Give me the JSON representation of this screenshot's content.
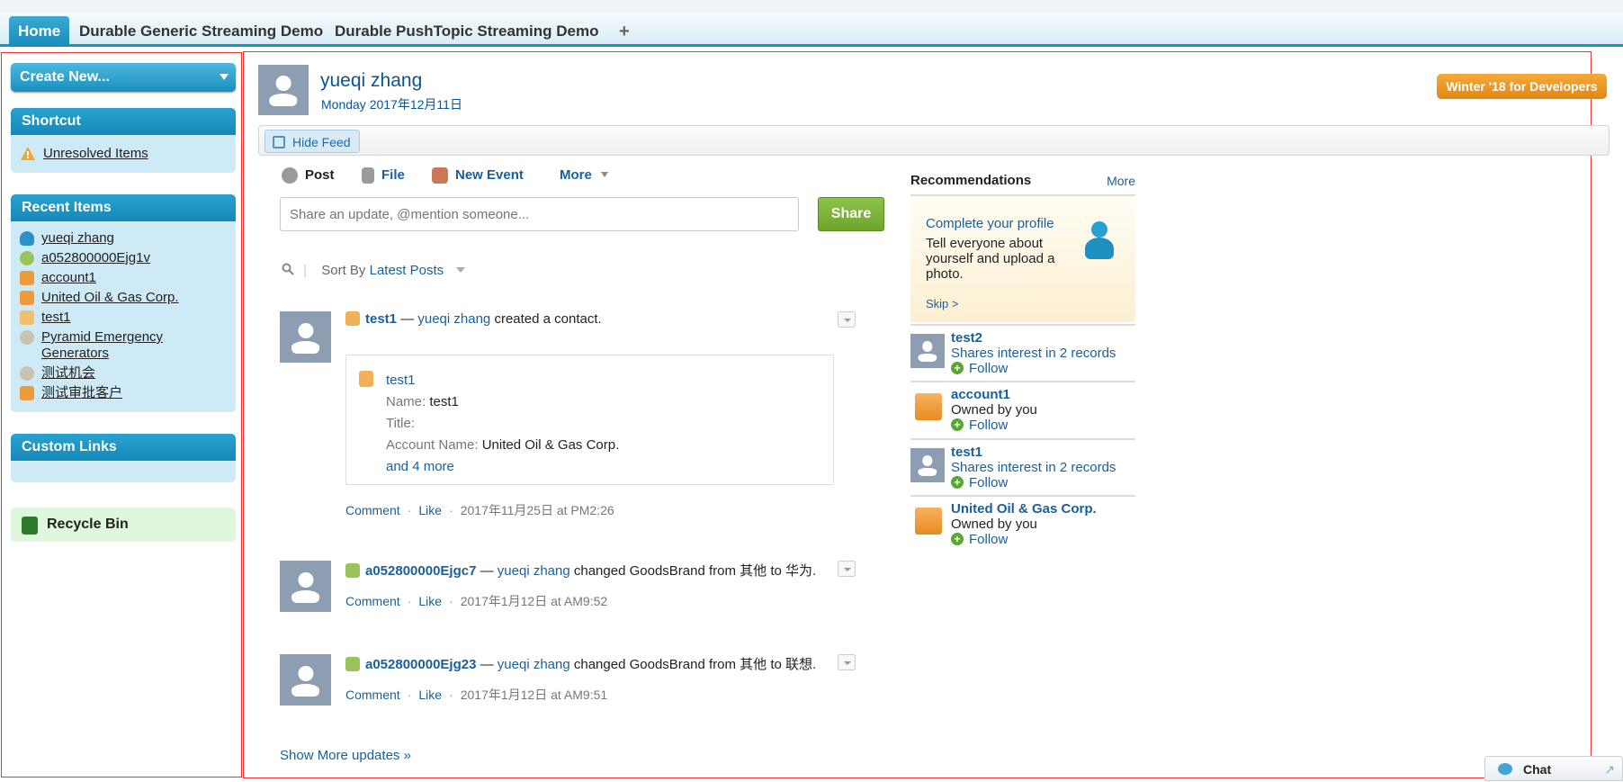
{
  "tabs": [
    "Home",
    "Durable Generic Streaming Demo",
    "Durable PushTopic Streaming Demo",
    "+"
  ],
  "sidebar": {
    "create_new": "Create New...",
    "shortcut_title": "Shortcut",
    "shortcut_items": [
      {
        "label": "Unresolved Items",
        "icon": "warning-icon"
      }
    ],
    "recent_title": "Recent Items",
    "recent_items": [
      {
        "label": "yueqi zhang",
        "icon": "user-icon"
      },
      {
        "label": "a052800000Ejg1v",
        "icon": "custom-object-icon"
      },
      {
        "label": "account1",
        "icon": "account-icon"
      },
      {
        "label": "United Oil & Gas Corp.",
        "icon": "account-icon"
      },
      {
        "label": "test1",
        "icon": "contact-icon"
      },
      {
        "label": "Pyramid Emergency Generators",
        "icon": "opportunity-icon"
      },
      {
        "label": "测试机会",
        "icon": "opportunity-icon"
      },
      {
        "label": "测试审批客户",
        "icon": "account-icon"
      }
    ],
    "custom_links_title": "Custom Links",
    "recycle_bin": "Recycle Bin"
  },
  "profile": {
    "name": "yueqi zhang",
    "date": "Monday 2017年12月11日"
  },
  "release_button": "Winter '18 for Developers",
  "feed": {
    "hide_feed": "Hide Feed",
    "composer_tabs": [
      "Post",
      "File",
      "New Event",
      "More"
    ],
    "share_placeholder": "Share an update, @mention someone...",
    "share_button": "Share",
    "sort_label": "Sort By",
    "sort_value": "Latest Posts",
    "comment": "Comment",
    "like": "Like",
    "posts": [
      {
        "actor": "test1",
        "dash": " — ",
        "user": "yueqi zhang",
        "text": " created a contact.",
        "card": {
          "name": "test1",
          "name_label": "Name:",
          "name_value": "test1",
          "title_label": "Title:",
          "account_label": "Account Name:",
          "account_value": "United Oil & Gas Corp.",
          "more": "and 4 more"
        },
        "timestamp": "2017年11月25日 at PM2:26"
      },
      {
        "actor": "a052800000Ejgc7",
        "dash": " — ",
        "user": "yueqi zhang",
        "text": " changed GoodsBrand from 其他 to 华为.",
        "timestamp": "2017年1月12日 at AM9:52"
      },
      {
        "actor": "a052800000Ejg23",
        "dash": " — ",
        "user": "yueqi zhang",
        "text": " changed GoodsBrand from 其他 to 联想.",
        "timestamp": "2017年1月12日 at AM9:51"
      }
    ],
    "show_more": "Show More updates »"
  },
  "recommendations": {
    "title": "Recommendations",
    "more": "More",
    "profile_prompt": {
      "title": "Complete your profile",
      "desc": "Tell everyone about yourself and upload a photo.",
      "skip": "Skip >"
    },
    "follow": "Follow",
    "items": [
      {
        "name": "test2",
        "sub": "Shares interest in 2 records",
        "kind": "user"
      },
      {
        "name": "account1",
        "sub": "Owned by you",
        "kind": "account"
      },
      {
        "name": "test1",
        "sub": "Shares interest in 2 records",
        "kind": "user"
      },
      {
        "name": "United Oil & Gas Corp.",
        "sub": "Owned by you",
        "kind": "account"
      }
    ]
  },
  "chat": "Chat"
}
